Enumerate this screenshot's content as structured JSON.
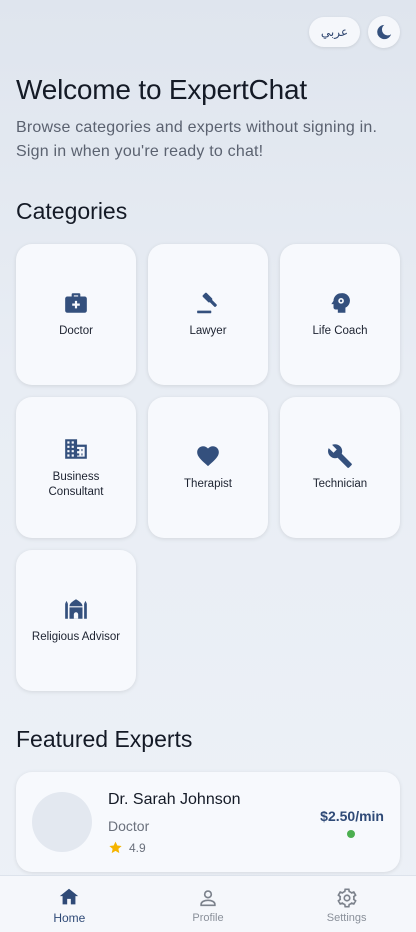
{
  "topbar": {
    "language_label": "عربي",
    "theme_icon": "moon-icon"
  },
  "welcome": {
    "title": "Welcome to ExpertChat",
    "subtitle": "Browse categories and experts without signing in. Sign in when you're ready to chat!"
  },
  "categories": {
    "title": "Categories",
    "items": [
      {
        "label": "Doctor",
        "icon": "medical-bag-icon"
      },
      {
        "label": "Lawyer",
        "icon": "gavel-icon"
      },
      {
        "label": "Life Coach",
        "icon": "head-gear-icon"
      },
      {
        "label": "Business Consultant",
        "icon": "building-icon"
      },
      {
        "label": "Therapist",
        "icon": "heart-icon"
      },
      {
        "label": "Technician",
        "icon": "wrench-icon"
      },
      {
        "label": "Religious Advisor",
        "icon": "mosque-icon"
      }
    ]
  },
  "featured": {
    "title": "Featured Experts",
    "experts": [
      {
        "name": "Dr. Sarah Johnson",
        "role": "Doctor",
        "rating": "4.9",
        "price": "$2.50/min",
        "online": true
      }
    ]
  },
  "nav": {
    "items": [
      {
        "label": "Home",
        "icon": "home-icon",
        "active": true
      },
      {
        "label": "Profile",
        "icon": "person-icon",
        "active": false
      },
      {
        "label": "Settings",
        "icon": "gear-icon",
        "active": false
      }
    ]
  },
  "colors": {
    "accent": "#2f4a77",
    "icon": "#34507d",
    "online": "#4caf50",
    "star": "#f5b400"
  }
}
